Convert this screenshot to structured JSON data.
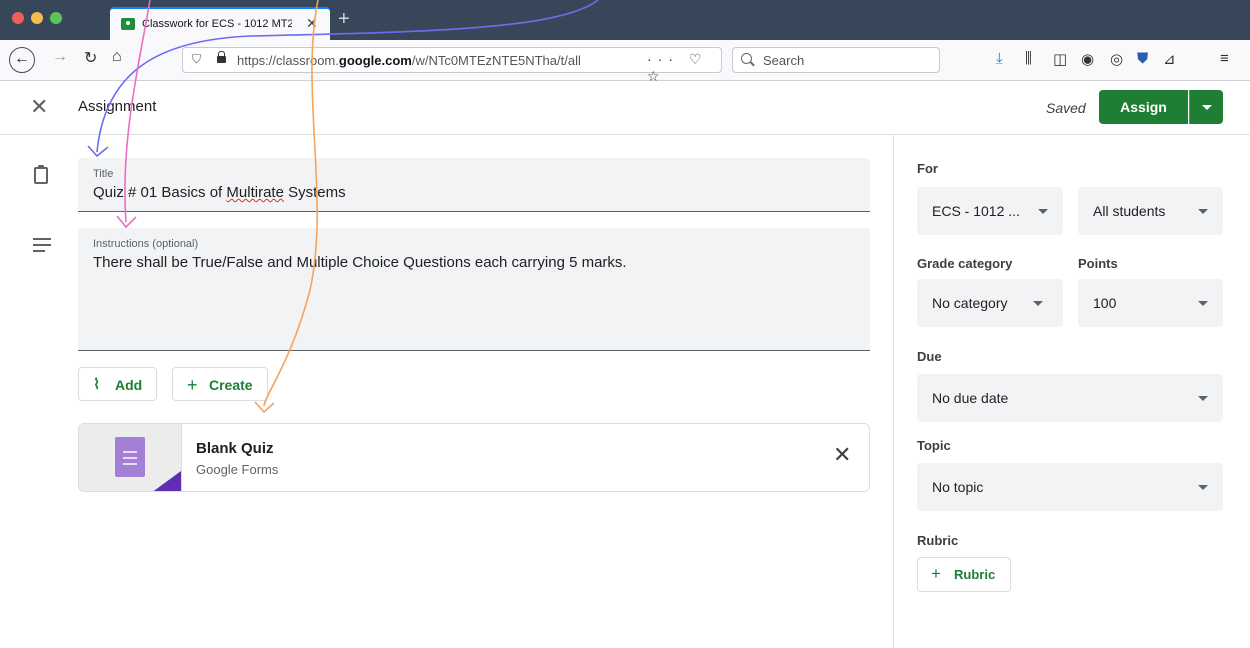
{
  "browser": {
    "tab_title": "Classwork for ECS - 1012 MT20",
    "url_prefix": "https://classroom.",
    "url_domain": "google.com",
    "url_path": "/w/NTc0MTEzNTE5NTha/t/all",
    "search_placeholder": "Search"
  },
  "header": {
    "title": "Assignment",
    "saved": "Saved",
    "assign_label": "Assign"
  },
  "form": {
    "title_label": "Title",
    "title_before": "Quiz # 01 Basics of ",
    "title_misspelled": "Multirate",
    "title_after": " Systems",
    "instructions_label": "Instructions (optional)",
    "instructions_value": "There shall be True/False and Multiple Choice Questions each carrying 5 marks.",
    "add_label": "Add",
    "create_label": "Create"
  },
  "attachment": {
    "title": "Blank Quiz",
    "subtitle": "Google Forms"
  },
  "sidebar": {
    "for_label": "For",
    "class_value": "ECS - 1012 ...",
    "students_value": "All students",
    "grade_category_label": "Grade category",
    "grade_category_value": "No category",
    "points_label": "Points",
    "points_value": "100",
    "due_label": "Due",
    "due_value": "No due date",
    "topic_label": "Topic",
    "topic_value": "No topic",
    "rubric_label": "Rubric",
    "rubric_button": "Rubric"
  },
  "colors": {
    "accent_green": "#1e7e34",
    "annotation_blue": "#6c6cf0",
    "annotation_pink": "#ec6bc8",
    "annotation_orange": "#f4a45c"
  }
}
